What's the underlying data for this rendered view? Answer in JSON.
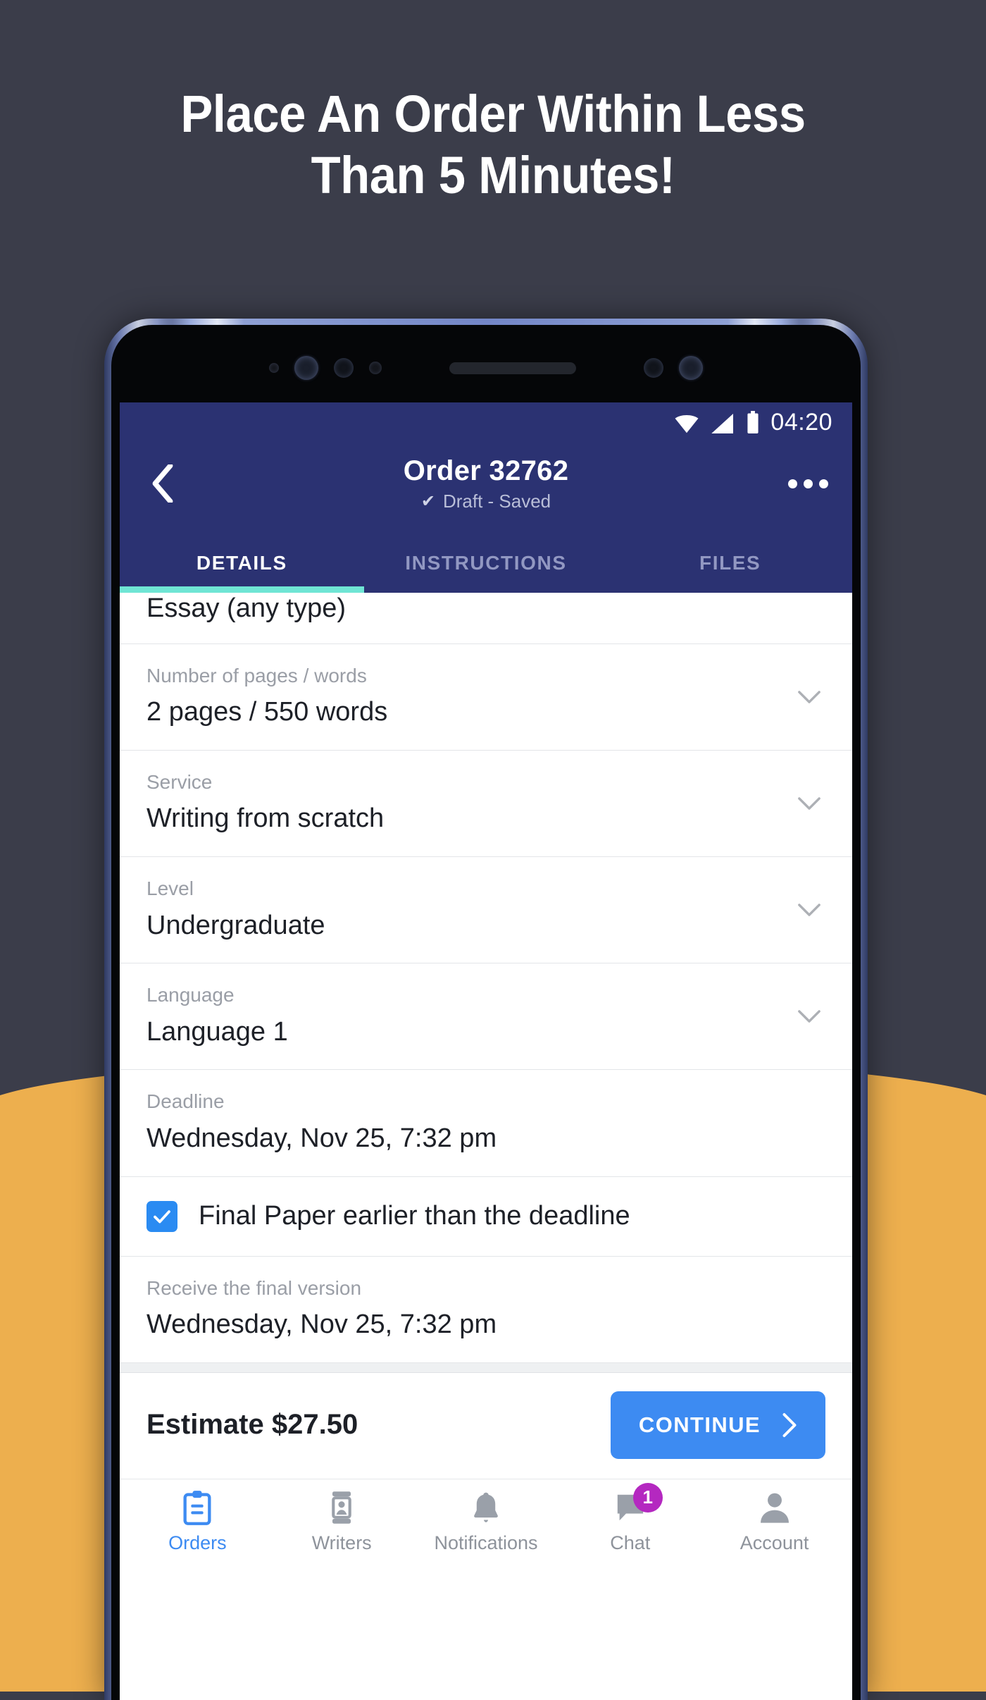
{
  "headline": {
    "line1": "Place An Order Within Less",
    "line2": "Than 5 Minutes!"
  },
  "colors": {
    "background": "#3b3d4a",
    "orange": "#edaf4e",
    "header_navy": "#2b3272",
    "accent_blue": "#3d8bf2",
    "tab_underline": "#6fe5d4",
    "badge_purple": "#b428c0",
    "checkbox_blue": "#2a8bf2"
  },
  "statusbar": {
    "time": "04:20",
    "icons": [
      "wifi-icon",
      "signal-icon",
      "battery-icon"
    ]
  },
  "header": {
    "back_icon": "chevron-left-icon",
    "title": "Order 32762",
    "status_tick": "✔",
    "status_text": "Draft - Saved",
    "menu_icon": "overflow-menu-icon"
  },
  "tabs": [
    {
      "label": "DETAILS",
      "active": true
    },
    {
      "label": "INSTRUCTIONS",
      "active": false
    },
    {
      "label": "FILES",
      "active": false
    }
  ],
  "form": {
    "rows": [
      {
        "label": "",
        "value": "Essay (any type)",
        "chevron": false,
        "clipped": true
      },
      {
        "label": "Number of pages / words",
        "value": "2 pages / 550 words",
        "chevron": true
      },
      {
        "label": "Service",
        "value": "Writing from scratch",
        "chevron": true
      },
      {
        "label": "Level",
        "value": "Undergraduate",
        "chevron": true
      },
      {
        "label": "Language",
        "value": "Language 1",
        "chevron": true
      },
      {
        "label": "Deadline",
        "value": "Wednesday, Nov 25, 7:32 pm",
        "chevron": false
      }
    ],
    "checkbox": {
      "checked": true,
      "label": "Final Paper earlier than the deadline"
    },
    "final_version": {
      "label": "Receive the final version",
      "value": "Wednesday, Nov 25, 7:32 pm"
    }
  },
  "footer": {
    "estimate": "Estimate $27.50",
    "continue_label": "CONTINUE",
    "continue_icon": "chevron-right-icon"
  },
  "bottom_nav": [
    {
      "label": "Orders",
      "icon": "clipboard-icon",
      "active": true,
      "badge": null
    },
    {
      "label": "Writers",
      "icon": "contact-card-icon",
      "active": false,
      "badge": null
    },
    {
      "label": "Notifications",
      "icon": "bell-icon",
      "active": false,
      "badge": null
    },
    {
      "label": "Chat",
      "icon": "chat-bubble-icon",
      "active": false,
      "badge": "1"
    },
    {
      "label": "Account",
      "icon": "person-icon",
      "active": false,
      "badge": null
    }
  ]
}
